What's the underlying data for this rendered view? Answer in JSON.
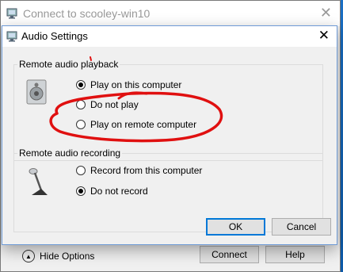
{
  "parent": {
    "title": "Connect to scooley-win10",
    "hide_options": "Hide Options",
    "connect_label": "Connect",
    "help_label": "Help"
  },
  "dialog": {
    "title": "Audio Settings",
    "playback": {
      "label": "Remote audio playback",
      "options": [
        "Play on this computer",
        "Do not play",
        "Play on remote computer"
      ],
      "selected": 0
    },
    "recording": {
      "label": "Remote audio recording",
      "options": [
        "Record from this computer",
        "Do not record"
      ],
      "selected": 1
    },
    "ok_label": "OK",
    "cancel_label": "Cancel"
  },
  "colors": {
    "annotation": "#e01010",
    "accent": "#0078d7"
  }
}
